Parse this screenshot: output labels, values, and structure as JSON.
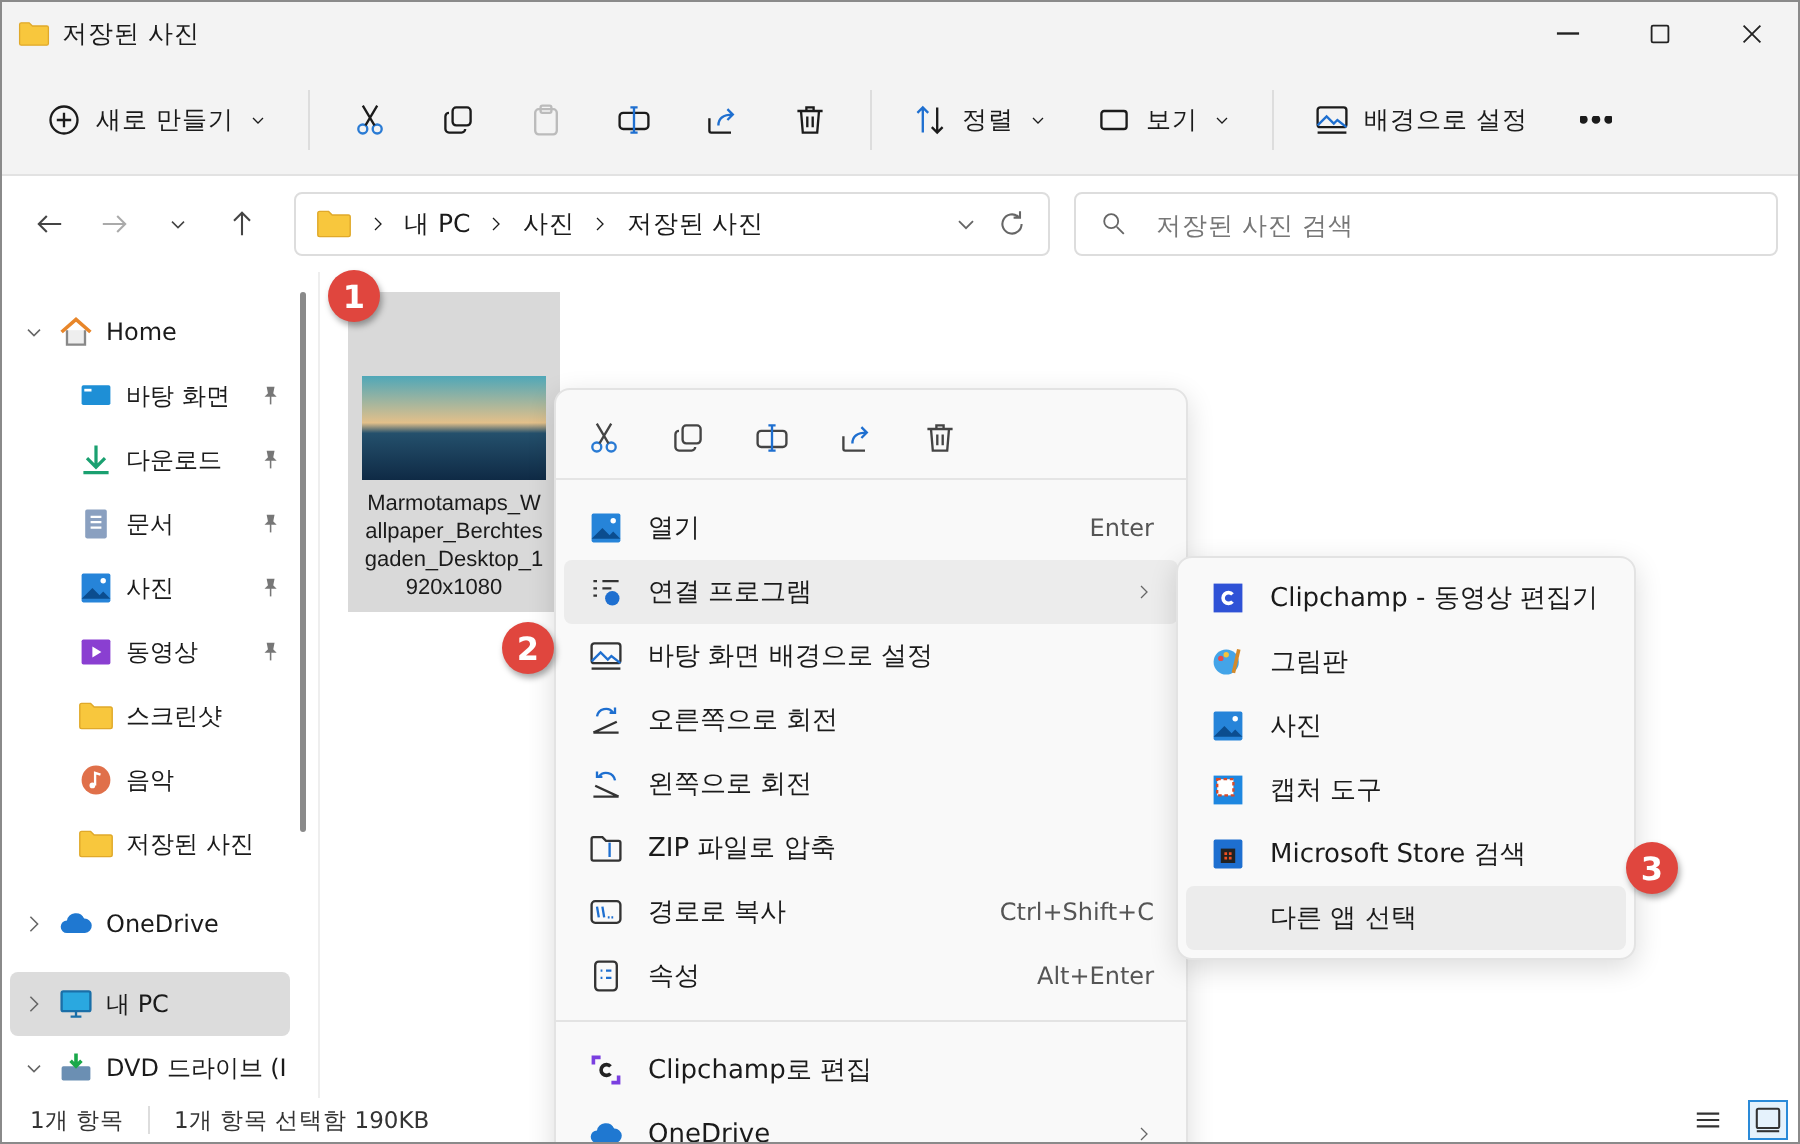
{
  "window": {
    "title": "저장된 사진"
  },
  "toolbar": [
    {
      "kind": "new",
      "label": "새로 만들기",
      "dropdown": true,
      "disabled": false
    },
    {
      "kind": "cut",
      "disabled": false
    },
    {
      "kind": "copy",
      "disabled": false
    },
    {
      "kind": "paste",
      "disabled": true
    },
    {
      "kind": "rename",
      "disabled": false
    },
    {
      "kind": "share",
      "disabled": false
    },
    {
      "kind": "delete",
      "disabled": false
    },
    {
      "kind": "sort",
      "label": "정렬",
      "dropdown": true,
      "disabled": false
    },
    {
      "kind": "view",
      "label": "보기",
      "dropdown": true,
      "disabled": false
    },
    {
      "kind": "wallpaper",
      "label": "배경으로 설정",
      "dropdown": false,
      "disabled": false
    },
    {
      "kind": "more",
      "disabled": false
    }
  ],
  "address": {
    "crumbs": [
      "내 PC",
      "사진",
      "저장된 사진"
    ]
  },
  "search": {
    "placeholder": "저장된 사진 검색"
  },
  "sidebar": {
    "items": [
      {
        "kind": "home",
        "label": "Home",
        "expanded": true,
        "selected": false,
        "children": [
          {
            "kind": "desktop",
            "label": "바탕 화면",
            "pinned": true,
            "selected": false
          },
          {
            "kind": "download",
            "label": "다운로드",
            "pinned": true,
            "selected": false
          },
          {
            "kind": "document",
            "label": "문서",
            "pinned": true,
            "selected": false
          },
          {
            "kind": "pictures",
            "label": "사진",
            "pinned": true,
            "selected": false
          },
          {
            "kind": "video",
            "label": "동영상",
            "pinned": true,
            "selected": false
          },
          {
            "kind": "folder",
            "label": "스크린샷",
            "pinned": false,
            "selected": false
          },
          {
            "kind": "music",
            "label": "음악",
            "pinned": false,
            "selected": false
          },
          {
            "kind": "folder",
            "label": "저장된 사진",
            "pinned": false,
            "selected": false
          }
        ]
      },
      {
        "kind": "onedrive",
        "label": "OneDrive",
        "expanded": false,
        "selected": false
      },
      {
        "kind": "pc",
        "label": "내 PC",
        "expanded": false,
        "selected": true
      },
      {
        "kind": "dvd",
        "label": "DVD 드라이브 (I",
        "expanded": true,
        "selected": false
      }
    ]
  },
  "files": [
    {
      "name": "Marmotamaps_Wallpaper_Berchtesgaden_Desktop_1920x1080",
      "selected": true
    }
  ],
  "context_menu": {
    "actions": [
      {
        "kind": "cut"
      },
      {
        "kind": "copy"
      },
      {
        "kind": "rename"
      },
      {
        "kind": "share"
      },
      {
        "kind": "delete"
      }
    ],
    "items": [
      {
        "kind": "open",
        "label": "열기",
        "shortcut": "Enter",
        "submenu": false,
        "selected": false
      },
      {
        "kind": "openwith",
        "label": "연결 프로그램",
        "submenu": true,
        "selected": true
      },
      {
        "kind": "wallpaper",
        "label": "바탕 화면 배경으로 설정",
        "submenu": false,
        "selected": false
      },
      {
        "kind": "rotateright",
        "label": "오른쪽으로 회전",
        "submenu": false,
        "selected": false
      },
      {
        "kind": "rotateleft",
        "label": "왼쪽으로 회전",
        "submenu": false,
        "selected": false
      },
      {
        "kind": "zip",
        "label": "ZIP 파일로 압축",
        "submenu": false,
        "selected": false
      },
      {
        "kind": "copypath",
        "label": "경로로 복사",
        "shortcut": "Ctrl+Shift+C",
        "submenu": false,
        "selected": false
      },
      {
        "kind": "properties",
        "label": "속성",
        "shortcut": "Alt+Enter",
        "submenu": false,
        "selected": false
      },
      {
        "kind": "separator"
      },
      {
        "kind": "clipchamp",
        "label": "Clipchamp로 편집",
        "submenu": false,
        "selected": false
      },
      {
        "kind": "onedrive",
        "label": "OneDrive",
        "submenu": true,
        "selected": false
      }
    ]
  },
  "submenu": {
    "items": [
      {
        "kind": "clipchampapp",
        "label": "Clipchamp - 동영상 편집기",
        "selected": false
      },
      {
        "kind": "paint",
        "label": "그림판",
        "selected": false
      },
      {
        "kind": "photos",
        "label": "사진",
        "selected": false
      },
      {
        "kind": "snip",
        "label": "캡처 도구",
        "selected": false
      },
      {
        "kind": "store",
        "label": "Microsoft Store 검색",
        "selected": false
      },
      {
        "kind": "other",
        "label": "다른 앱 선택",
        "selected": true
      }
    ]
  },
  "callouts": [
    "1",
    "2",
    "3"
  ],
  "status_bar": {
    "count": "1개 항목",
    "selection": "1개 항목 선택함 190KB",
    "views": [
      {
        "kind": "details",
        "selected": false
      },
      {
        "kind": "tiles",
        "selected": true
      }
    ]
  }
}
